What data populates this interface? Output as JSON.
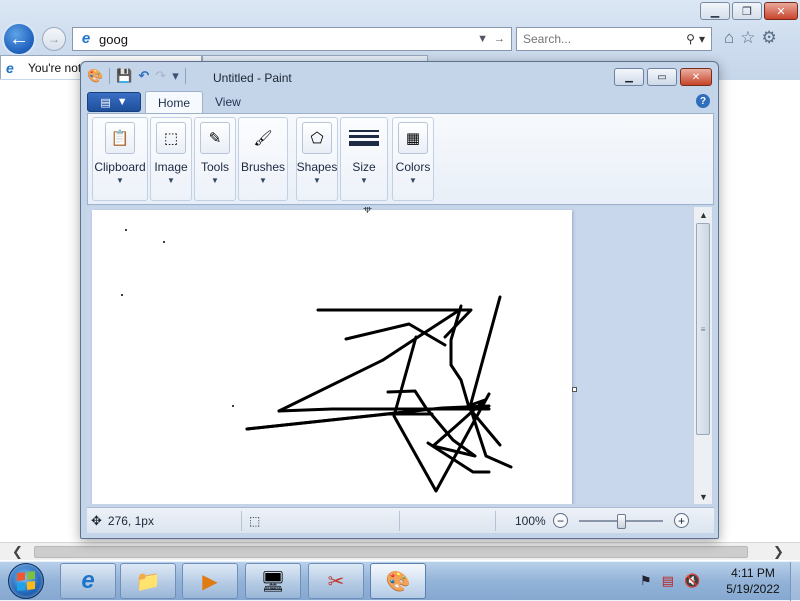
{
  "browser": {
    "address": "goog",
    "search_placeholder": "Search...",
    "tab_label": "You're not",
    "icons": [
      "back-icon",
      "forward-icon",
      "home-icon",
      "favorites-icon",
      "gear-icon"
    ]
  },
  "paint": {
    "title": "Untitled - Paint",
    "ribbon_tabs": [
      "Home",
      "View"
    ],
    "groups": {
      "clipboard": "Clipboard",
      "image": "Image",
      "tools": "Tools",
      "brushes": "Brushes",
      "shapes": "Shapes",
      "size": "Size",
      "colors": "Colors"
    },
    "status": {
      "position": "276, 1px",
      "zoom": "100%",
      "zoom_level": 1.0
    }
  },
  "taskbar": {
    "time": "4:11 PM",
    "date": "5/19/2022",
    "apps": [
      "internet-explorer",
      "windows-explorer",
      "media-player",
      "control-panel",
      "snipping-tool",
      "paint"
    ]
  },
  "colors": {
    "accent": "#1e5fbc",
    "stroke": "#000000"
  }
}
